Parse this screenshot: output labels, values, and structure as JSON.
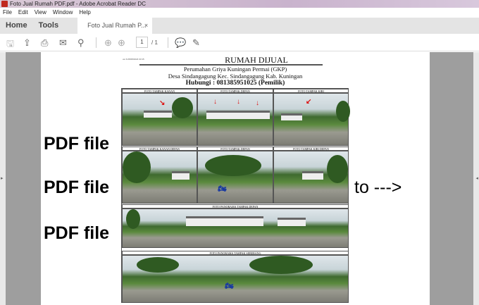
{
  "window": {
    "title": "Foto Jual Rumah PDF.pdf - Adobe Acrobat Reader DC"
  },
  "menu": [
    "File",
    "Edit",
    "View",
    "Window",
    "Help"
  ],
  "tabs": {
    "home": "Home",
    "tools": "Tools",
    "doc": "Foto Jual Rumah P...",
    "close": "×"
  },
  "toolbar": {
    "page_current": "1",
    "page_total": "/ 1"
  },
  "document": {
    "small_note": "ver.6.05/08/2024 03:15",
    "title": "RUMAH DIJUAL",
    "line1": "Perumahan Griya Kuningan Permai (GKP)",
    "line2": "Desa Sindangagung Kec. Sindangagung Kab. Kuningan",
    "line3": "Hubungi : 081385951025 (Pemilik)",
    "captions": [
      "FOTO TAMPAK KANAN",
      "FOTO TAMPAK DEPAN",
      "FOTO TAMPAK KIRI",
      "FOTO TAMPAK KANAN DEPAN",
      "FOTO TAMPAK DEPAN",
      "FOTO TAMPAK KIRI DEPAN",
      "FOTO PANORAMA TAMPAK DEPAN",
      "FOTO PANORAMA TAMPAK SEBERANG"
    ]
  },
  "overlay": {
    "labels": [
      "PDF file",
      "PDF file",
      "PDF file"
    ],
    "to": "to --->"
  }
}
